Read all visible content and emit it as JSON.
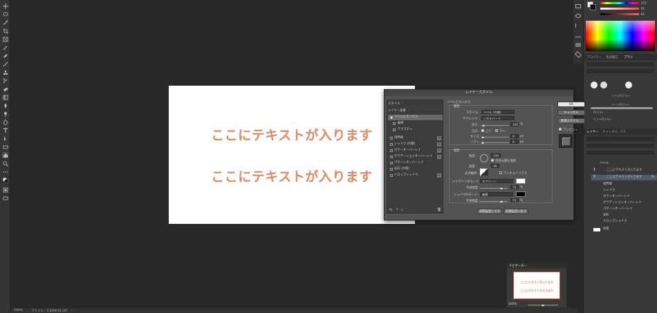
{
  "canvas": {
    "line1": "ここにテキストが入ります",
    "line2": "ここにテキストが入ります"
  },
  "status": {
    "zoom": "100%",
    "doc": "ファイル : 5.00M/10.2M"
  },
  "right_panel": {
    "color_values": [
      "272",
      "85",
      "85"
    ],
    "tabs": [
      "プロパティ",
      "色調補正",
      "ブラシ"
    ],
    "brush_names": [
      "円ブラシ",
      "ソフト円ブラシ",
      "ハード円ブラシ",
      "円ブラシ",
      "ソフト円ブラシ"
    ],
    "brush_list": [
      "ソフト円",
      "ハード円",
      "ソフト円ブラシ",
      "円ブラシ",
      "ソフト円ブラシ",
      "ハード円ブラシ"
    ],
    "layer_tabs": [
      "レイヤー",
      "チャンネル",
      "パス"
    ],
    "layer_rows": [
      "ベベル",
      "ここにテキストが入ります",
      "ここにテキストが入ります",
      "境界線",
      "シャドウ",
      "カラーオーバーレイ",
      "グラデーションオーバーレイ",
      "パターンオーバーレイ",
      "光彩",
      "ドロップシャドウ",
      "背景"
    ]
  },
  "dialog": {
    "title": "レイヤースタイル",
    "styles_header": "スタイル",
    "blend_header": "レイヤー効果",
    "styles": [
      {
        "label": "ベベルとエンボス",
        "checked": true,
        "selected": true,
        "plus": false
      },
      {
        "label": "輪郭",
        "checked": false,
        "selected": false,
        "plus": false
      },
      {
        "label": "テクスチャ",
        "checked": false,
        "selected": false,
        "plus": false
      },
      {
        "label": "境界線",
        "checked": false,
        "selected": false,
        "plus": true
      },
      {
        "label": "シャドウ (内側)",
        "checked": false,
        "selected": false,
        "plus": true
      },
      {
        "label": "カラーオーバーレイ",
        "checked": false,
        "selected": false,
        "plus": true
      },
      {
        "label": "グラデーションオーバーレイ",
        "checked": false,
        "selected": false,
        "plus": true
      },
      {
        "label": "パターンオーバーレイ",
        "checked": false,
        "selected": false,
        "plus": false
      },
      {
        "label": "光彩 (外側)",
        "checked": false,
        "selected": false,
        "plus": false
      },
      {
        "label": "ドロップシャドウ",
        "checked": false,
        "selected": false,
        "plus": true
      }
    ],
    "bevel": {
      "section": "ベベルとエンボス",
      "structure": "構造",
      "style_label": "スタイル :",
      "style_value": "ベベル (内側)",
      "technique_label": "テクニック :",
      "technique_value": "シゼルハード",
      "depth_label": "深さ :",
      "depth_value": "100",
      "depth_unit": "%",
      "direction_label": "方向 :",
      "direction_up": "上へ",
      "direction_down": "下へ",
      "size_label": "サイズ :",
      "size_value": "0",
      "size_unit": "px",
      "soften_label": "ソフト :",
      "soften_value": "0",
      "soften_unit": "px"
    },
    "shading": {
      "section": "陰影",
      "angle_label": "角度 :",
      "angle_value": "110",
      "global_light": "包括光源を使用",
      "altitude_label": "高度 :",
      "altitude_value": "30",
      "gloss_label": "光沢輪郭 :",
      "antialias": "アンチエイリアス",
      "highlight_label": "ハイライトのモード :",
      "highlight_value": "スクリーン",
      "highlight_color": "#ffffff",
      "highlight_opacity_label": "不透明度 :",
      "highlight_opacity": "75",
      "shadow_label": "シャドウのモード :",
      "shadow_value": "乗算",
      "shadow_color": "#000000",
      "shadow_opacity_label": "不透明度 :",
      "shadow_opacity": "75",
      "opacity_unit": "%"
    },
    "buttons": {
      "ok": "OK",
      "cancel": "キャンセル",
      "new_style": "新規スタイル...",
      "preview": "プレビュー",
      "make_default": "初期設定にする",
      "reset_default": "初期設定に戻す"
    }
  },
  "navigator": {
    "title": "ナビゲーター",
    "line1": "ここにテキストが入ります",
    "line2": "ここにテキストが入ります",
    "zoom": "100%"
  },
  "colors": {
    "text_orange": "#e08a66",
    "bg_dark": "#282828",
    "dialog_bg": "#535353"
  }
}
